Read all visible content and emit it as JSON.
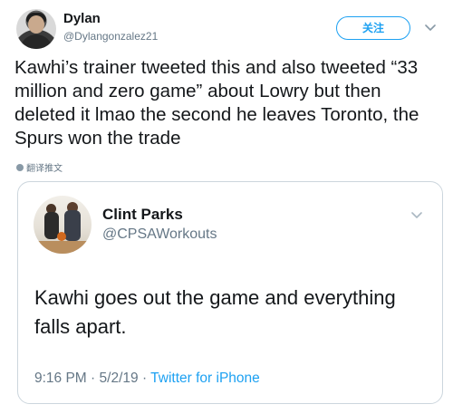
{
  "tweet": {
    "display_name": "Dylan",
    "handle": "@Dylangonzalez21",
    "follow_label": "关注",
    "text": "Kawhi’s trainer tweeted this and also tweeted “33 million and zero game” about Lowry but then deleted it lmao the second he leaves Toronto, the Spurs won the trade",
    "translate_label": "翻译推文",
    "icons": {
      "avatar": "profile-photo",
      "menu": "chevron-down-icon",
      "translate": "globe-icon"
    }
  },
  "quoted_tweet": {
    "display_name": "Clint Parks",
    "handle": "@CPSAWorkouts",
    "text": "Kawhi goes out the game and everything falls apart.",
    "time": "9:16 PM",
    "separator": "·",
    "date": "5/2/19",
    "source": "Twitter for iPhone",
    "icons": {
      "avatar": "profile-photo",
      "menu": "chevron-down-icon"
    }
  },
  "colors": {
    "accent": "#1da1f2",
    "text": "#14171a",
    "muted": "#657786",
    "border": "#ccd6dd"
  }
}
